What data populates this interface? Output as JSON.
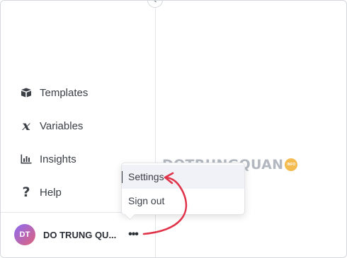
{
  "sidebar": {
    "items": [
      {
        "label": "Templates",
        "icon": "box-icon"
      },
      {
        "label": "Variables",
        "icon": "variable-icon"
      },
      {
        "label": "Insights",
        "icon": "bar-chart-icon"
      },
      {
        "label": "Help",
        "icon": "question-icon"
      }
    ],
    "variables_glyph": "x",
    "help_glyph": "?",
    "user": {
      "initials": "DT",
      "name": "DO TRUNG QU...",
      "more_glyph": "•••"
    }
  },
  "menu": {
    "settings_label": "Settings",
    "signout_label": "Sign out"
  },
  "watermark": {
    "text": "DOTRUNGQUAN",
    "badge": "INFO"
  },
  "colors": {
    "annotation_arrow": "#e0344b",
    "menu_highlight": "#f1f2f8",
    "avatar_gradient_start": "#8b6bf2",
    "avatar_gradient_end": "#e0637a",
    "watermark_badge": "#f3b43b"
  }
}
